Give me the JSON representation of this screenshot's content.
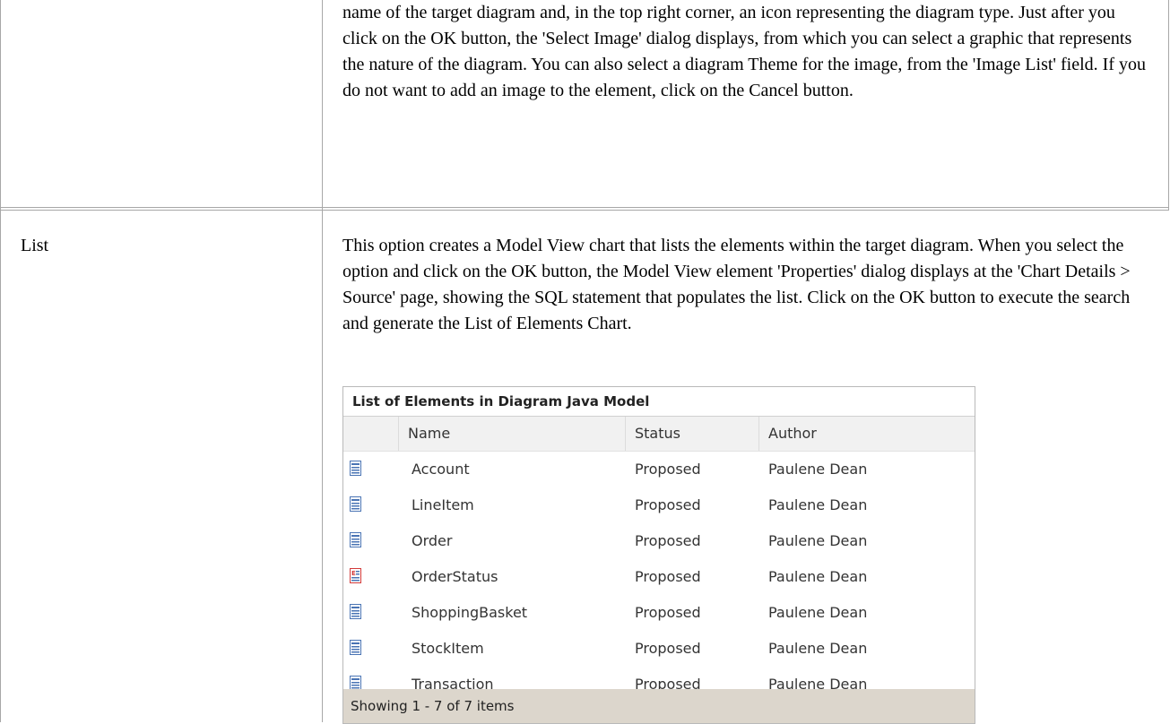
{
  "row1": {
    "text": "name of the target diagram and, in the top right corner, an icon representing the diagram type. Just after you click on the OK button, the 'Select Image' dialog displays, from which you can select a graphic that represents the nature of the diagram. You can also select a diagram Theme for the image, from the 'Image List' field. If you do not want to add an image to the element, click on the Cancel button."
  },
  "row2": {
    "label": "List",
    "text": "This option creates a Model View chart that lists the elements within the target diagram. When you select the option and click on the OK button, the Model View element 'Properties' dialog displays at the 'Chart Details > Source' page, showing the SQL statement that populates the list. Click on the OK button to execute the search and generate the List of Elements Chart."
  },
  "panel": {
    "title": "List of Elements in Diagram Java Model",
    "columns": [
      "Name",
      "Status",
      "Author"
    ],
    "rows": [
      {
        "icon": "class-icon",
        "name": "Account",
        "status": "Proposed",
        "author": "Paulene Dean"
      },
      {
        "icon": "class-icon",
        "name": "LineItem",
        "status": "Proposed",
        "author": "Paulene Dean"
      },
      {
        "icon": "class-icon",
        "name": "Order",
        "status": "Proposed",
        "author": "Paulene Dean"
      },
      {
        "icon": "enumeration-icon",
        "name": "OrderStatus",
        "status": "Proposed",
        "author": "Paulene Dean"
      },
      {
        "icon": "class-icon",
        "name": "ShoppingBasket",
        "status": "Proposed",
        "author": "Paulene Dean"
      },
      {
        "icon": "class-icon",
        "name": "StockItem",
        "status": "Proposed",
        "author": "Paulene Dean"
      },
      {
        "icon": "class-icon",
        "name": "Transaction",
        "status": "Proposed",
        "author": "Paulene Dean"
      }
    ],
    "footer": "Showing 1 - 7 of 7 items"
  },
  "colors": {
    "border": "#a7a7a7",
    "header_bg": "#f1f1f1",
    "footer_bg": "#dcd6cc",
    "class_icon": "#4a74b4",
    "enum_icon": "#d23a3a"
  }
}
